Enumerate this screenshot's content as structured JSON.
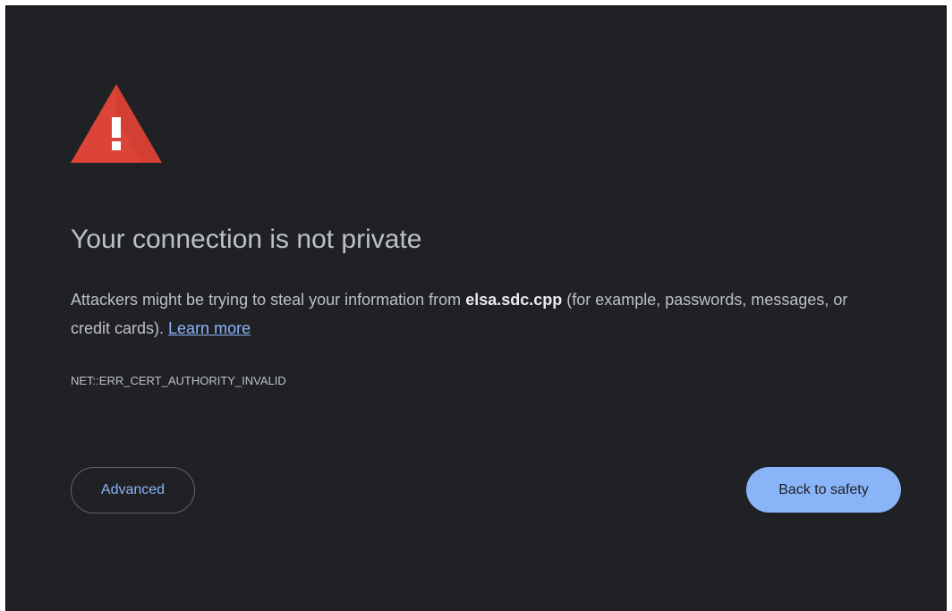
{
  "page": {
    "title": "Your connection is not private",
    "message": {
      "before": "Attackers might be trying to steal your information from ",
      "domain": "elsa.sdc.cpp",
      "after": " (for example, passwords, messages, or credit cards). ",
      "link": "Learn more"
    },
    "error_code": "NET::ERR_CERT_AUTHORITY_INVALID",
    "buttons": {
      "advanced": "Advanced",
      "back_to_safety": "Back to safety"
    }
  },
  "icons": {
    "warning": "warning-triangle-icon"
  },
  "colors": {
    "background": "#202124",
    "text": "#bdc1c6",
    "link": "#8ab4f8",
    "primary_button": "#8ab4f8",
    "warning_red": "#db4437"
  }
}
